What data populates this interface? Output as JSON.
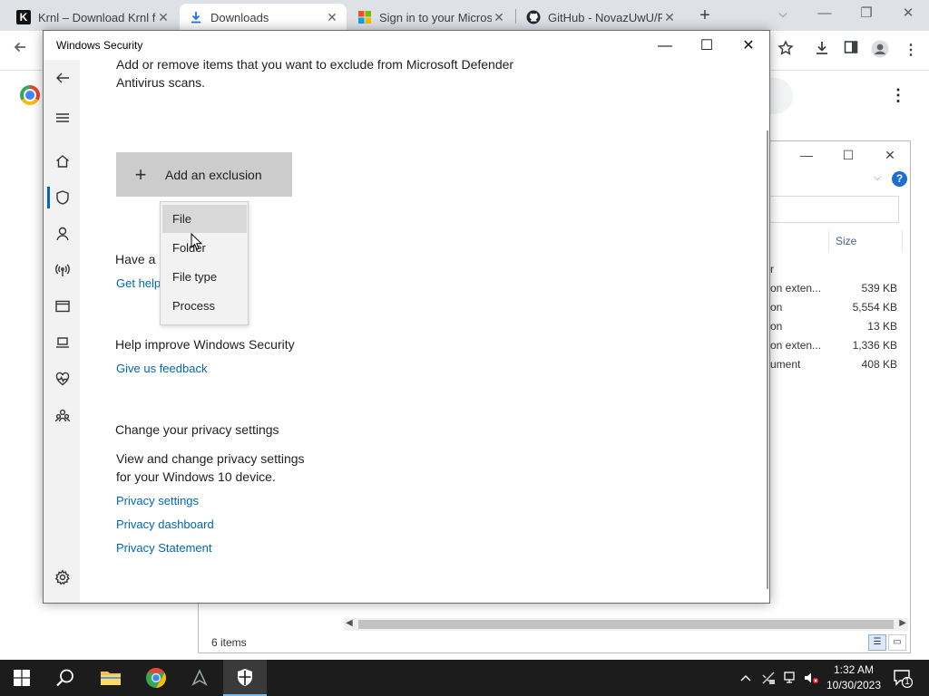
{
  "browser": {
    "tabs": [
      {
        "title": "Krnl – Download Krnl f",
        "favicon": "K",
        "close": "✕",
        "active": false
      },
      {
        "title": "Downloads",
        "favicon": "download-icon",
        "close": "✕",
        "active": true
      },
      {
        "title": "Sign in to your Microsc",
        "favicon": "microsoft-logo",
        "close": "✕",
        "active": false
      },
      {
        "title": "GitHub - NovazUwU/R",
        "favicon": "github-logo",
        "close": "✕",
        "active": false
      }
    ],
    "new_tab": "+",
    "window_controls": {
      "minimize": "—",
      "restore": "❐",
      "close": "✕"
    },
    "tab_search": "⌵",
    "menu": "⋮"
  },
  "explorer": {
    "column_header": "Size",
    "partial_header": "r",
    "rows": [
      {
        "type": "on exten...",
        "size": "539 KB"
      },
      {
        "type": "on",
        "size": "5,554 KB"
      },
      {
        "type": "on",
        "size": "13 KB"
      },
      {
        "type": "on exten...",
        "size": "1,336 KB"
      },
      {
        "type": "ument",
        "size": "408 KB"
      }
    ],
    "status": "6 items",
    "help": "?"
  },
  "security": {
    "window_title": "Windows Security",
    "window_controls": {
      "minimize": "—",
      "maximize": "☐",
      "close": "✕"
    },
    "intro_line1": "Add or remove items that you want to exclude from Microsoft Defender",
    "intro_line2": "Antivirus scans.",
    "add_button": {
      "icon": "+",
      "label": "Add an exclusion"
    },
    "menu": [
      "File",
      "Folder",
      "File type",
      "Process"
    ],
    "have_question_partial": "Have a",
    "get_help_partial": "Get help",
    "improve_heading": "Help improve Windows Security",
    "feedback_link": "Give us feedback",
    "privacy_heading": "Change your privacy settings",
    "privacy_text_line1": "View and change privacy settings",
    "privacy_text_line2": "for your Windows 10 device.",
    "privacy_links": [
      "Privacy settings",
      "Privacy dashboard",
      "Privacy Statement"
    ]
  },
  "taskbar": {
    "time": "1:32 AM",
    "date": "10/30/2023",
    "notification_count": "1"
  }
}
